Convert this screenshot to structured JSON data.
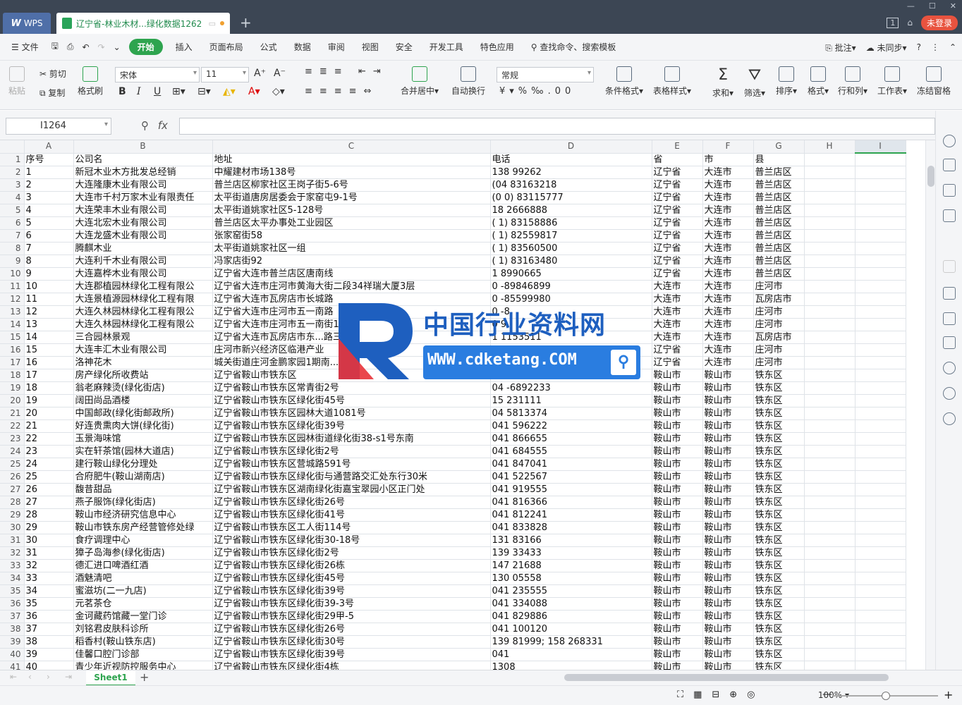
{
  "titlebar": {
    "wps_label": "WPS",
    "doc_title": "辽宁省-林业木材...绿化数据1262",
    "login_label": "未登录",
    "badge": "1"
  },
  "menu": {
    "file": "文件",
    "tabs": [
      "开始",
      "插入",
      "页面布局",
      "公式",
      "数据",
      "审阅",
      "视图",
      "安全",
      "开发工具",
      "特色应用"
    ],
    "search": "查找命令、搜索模板",
    "right": [
      "批注",
      "未同步"
    ]
  },
  "ribbon": {
    "paste": "粘贴",
    "cut": "剪切",
    "copy": "复制",
    "format_painter": "格式刷",
    "font_name": "宋体",
    "font_size": "11",
    "merge": "合并居中",
    "wrap": "自动换行",
    "number_format": "常规",
    "cond_format": "条件格式",
    "table_style": "表格样式",
    "sum": "求和",
    "filter": "筛选",
    "sort": "排序",
    "format": "格式",
    "rowcol": "行和列",
    "worksheet": "工作表",
    "freeze": "冻结窗格"
  },
  "formula": {
    "namebox": "I1264",
    "fx": "fx"
  },
  "columns": [
    "A",
    "B",
    "C",
    "D",
    "E",
    "F",
    "G",
    "H",
    "I"
  ],
  "rows": [
    [
      "1",
      "序号",
      "公司名",
      "地址",
      "电话",
      "省",
      "市",
      "县"
    ],
    [
      "2",
      "1",
      "新冠木业木方批发总经销",
      "中耀建材市场138号",
      "138  99262",
      "辽宁省",
      "大连市",
      "普兰店区"
    ],
    [
      "3",
      "2",
      "大连隆康木业有限公司",
      "普兰店区柳家社区王岗子街5-6号",
      "(04  83163218",
      "辽宁省",
      "大连市",
      "普兰店区"
    ],
    [
      "4",
      "3",
      "大连市千村万家木业有限责任",
      "太平街道唐房居委会于家窑屯9-1号",
      "(0  0) 83115777",
      "辽宁省",
      "大连市",
      "普兰店区"
    ],
    [
      "5",
      "4",
      "大连荣丰木业有限公司",
      "太平街道姚家社区5-128号",
      "18  2666888",
      "辽宁省",
      "大连市",
      "普兰店区"
    ],
    [
      "6",
      "5",
      "大连北宏木业有限公司",
      "普兰店区太平办事处工业园区",
      "(  1) 83158886",
      "辽宁省",
      "大连市",
      "普兰店区"
    ],
    [
      "7",
      "6",
      "大连龙盛木业有限公司",
      "张家窑街58",
      "(  1) 82559817",
      "辽宁省",
      "大连市",
      "普兰店区"
    ],
    [
      "8",
      "7",
      "腾麒木业",
      "太平街道姚家社区一组",
      "(  1) 83560500",
      "辽宁省",
      "大连市",
      "普兰店区"
    ],
    [
      "9",
      "8",
      "大连利千木业有限公司",
      "冯家店街92",
      "(  1) 83163480",
      "辽宁省",
      "大连市",
      "普兰店区"
    ],
    [
      "10",
      "9",
      "大连嘉桦木业有限公司",
      "辽宁省大连市普兰店区唐南线",
      "1  8990665",
      "辽宁省",
      "大连市",
      "普兰店区"
    ],
    [
      "11",
      "10",
      "大连郡植园林绿化工程有限公",
      "辽宁省大连市庄河市黄海大街二段34祥瑞大厦3层",
      "0  -89846899",
      "大连市",
      "大连市",
      "庄河市"
    ],
    [
      "12",
      "11",
      "大连景植源园林绿化工程有限",
      "辽宁省大连市瓦房店市长城路",
      "0  -85599980",
      "大连市",
      "大连市",
      "瓦房店市"
    ],
    [
      "13",
      "12",
      "大连久林园林绿化工程有限公",
      "辽宁省大连市庄河市五一南路",
      "0  -8     ",
      "大连市",
      "大连市",
      "庄河市"
    ],
    [
      "14",
      "13",
      "大连久林园林绿化工程有限公",
      "辽宁省大连市庄河市五一南街151号",
      "0  9  ",
      "大连市",
      "大连市",
      "庄河市"
    ],
    [
      "15",
      "14",
      "三合园林景观",
      "辽宁省大连市瓦房店市东...路三段6...1-8号附近",
      "1  1153511",
      "大连市",
      "大连市",
      "瓦房店市"
    ],
    [
      "16",
      "15",
      "大连丰汇木业有限公司",
      "庄河市新兴经济区临港产业",
      "(  1) 89578566",
      "辽宁省",
      "大连市",
      "庄河市"
    ],
    [
      "17",
      "16",
      "洛神花木",
      "城关街道庄河金鹏家园1期南...",
      "1  ",
      "辽宁省",
      "大连市",
      "庄河市"
    ],
    [
      "18",
      "17",
      "房产绿化所收费站",
      "辽宁省鞍山市铁东区",
      "0  -5832078",
      "鞍山市",
      "鞍山市",
      "铁东区"
    ],
    [
      "19",
      "18",
      "翁老麻辣烫(绿化街店)",
      "辽宁省鞍山市铁东区常青街2号",
      "04  -6892233",
      "鞍山市",
      "鞍山市",
      "铁东区"
    ],
    [
      "20",
      "19",
      "阔田尚品酒楼",
      "辽宁省鞍山市铁东区绿化街45号",
      "15  231111",
      "鞍山市",
      "鞍山市",
      "铁东区"
    ],
    [
      "21",
      "20",
      "中国邮政(绿化街邮政所)",
      "辽宁省鞍山市铁东区园林大道1081号",
      "04  5813374",
      "鞍山市",
      "鞍山市",
      "铁东区"
    ],
    [
      "22",
      "21",
      "好连贵熏肉大饼(绿化街)",
      "辽宁省鞍山市铁东区绿化街39号",
      "041  596222",
      "鞍山市",
      "鞍山市",
      "铁东区"
    ],
    [
      "23",
      "22",
      "玉景海味馆",
      "辽宁省鞍山市铁东区园林街道绿化街38-s1号东南",
      "041  866655",
      "鞍山市",
      "鞍山市",
      "铁东区"
    ],
    [
      "24",
      "23",
      "实在轩茶馆(园林大道店)",
      "辽宁省鞍山市铁东区绿化街2号",
      "041  684555",
      "鞍山市",
      "鞍山市",
      "铁东区"
    ],
    [
      "25",
      "24",
      "建行鞍山绿化分理处",
      "辽宁省鞍山市铁东区营城路591号",
      "041  847041",
      "鞍山市",
      "鞍山市",
      "铁东区"
    ],
    [
      "26",
      "25",
      "合府肥牛(鞍山湖南店)",
      "辽宁省鞍山市铁东区绿化街与通营路交汇处东行30米",
      "041  522567",
      "鞍山市",
      "鞍山市",
      "铁东区"
    ],
    [
      "27",
      "26",
      "馥昔甜品",
      "辽宁省鞍山市铁东区湖南绿化街嘉宝翠园小区正门处",
      "041  919555",
      "鞍山市",
      "鞍山市",
      "铁东区"
    ],
    [
      "28",
      "27",
      "燕子服饰(绿化街店)",
      "辽宁省鞍山市铁东区绿化街26号",
      "041  816366",
      "鞍山市",
      "鞍山市",
      "铁东区"
    ],
    [
      "29",
      "28",
      "鞍山市经济研究信息中心",
      "辽宁省鞍山市铁东区绿化街41号",
      "041  812241",
      "鞍山市",
      "鞍山市",
      "铁东区"
    ],
    [
      "30",
      "29",
      "鞍山市铁东房产经营管修处绿",
      "辽宁省鞍山市铁东区工人街114号",
      "041  833828",
      "鞍山市",
      "鞍山市",
      "铁东区"
    ],
    [
      "31",
      "30",
      "食疗调理中心",
      "辽宁省鞍山市铁东区绿化街30-18号",
      "131  83166",
      "鞍山市",
      "鞍山市",
      "铁东区"
    ],
    [
      "32",
      "31",
      "獐子岛海参(绿化街店)",
      "辽宁省鞍山市铁东区绿化街2号",
      "139  33433",
      "鞍山市",
      "鞍山市",
      "铁东区"
    ],
    [
      "33",
      "32",
      "德汇进口啤酒红酒",
      "辽宁省鞍山市铁东区绿化街26栋",
      "147  21688",
      "鞍山市",
      "鞍山市",
      "铁东区"
    ],
    [
      "34",
      "33",
      "酒魅清吧",
      "辽宁省鞍山市铁东区绿化街45号",
      "130  05558",
      "鞍山市",
      "鞍山市",
      "铁东区"
    ],
    [
      "35",
      "34",
      "蜜滋坊(二一九店)",
      "辽宁省鞍山市铁东区绿化街39号",
      "041  235555",
      "鞍山市",
      "鞍山市",
      "铁东区"
    ],
    [
      "36",
      "35",
      "元茗茶仓",
      "辽宁省鞍山市铁东区绿化街39-3号",
      "041  334088",
      "鞍山市",
      "鞍山市",
      "铁东区"
    ],
    [
      "37",
      "36",
      "金诃藏药馆藏一堂门诊",
      "辽宁省鞍山市铁东区绿化街29甲-5",
      "041  829886",
      "鞍山市",
      "鞍山市",
      "铁东区"
    ],
    [
      "38",
      "37",
      "刘铭君皮肤科诊所",
      "辽宁省鞍山市铁东区绿化街26号",
      "041  100120",
      "鞍山市",
      "鞍山市",
      "铁东区"
    ],
    [
      "39",
      "38",
      "稻香村(鞍山铁东店)",
      "辽宁省鞍山市铁东区绿化街30号",
      "139  81999; 158  268331",
      "鞍山市",
      "鞍山市",
      "铁东区"
    ],
    [
      "40",
      "39",
      "佳馨口腔门诊部",
      "辽宁省鞍山市铁东区绿化街39号",
      "041  ",
      "鞍山市",
      "鞍山市",
      "铁东区"
    ],
    [
      "41",
      "40",
      "青少年近视防控服务中心",
      "辽宁省鞍山市铁东区绿化街4栋",
      "1308  ",
      "鞍山市",
      "鞍山市",
      "铁东区"
    ]
  ],
  "sheetbar": {
    "tab": "Sheet1"
  },
  "status": {
    "zoom": "100%"
  },
  "watermark": {
    "title": "中国行业资料网",
    "url": "WWW.cdketang.COM"
  }
}
